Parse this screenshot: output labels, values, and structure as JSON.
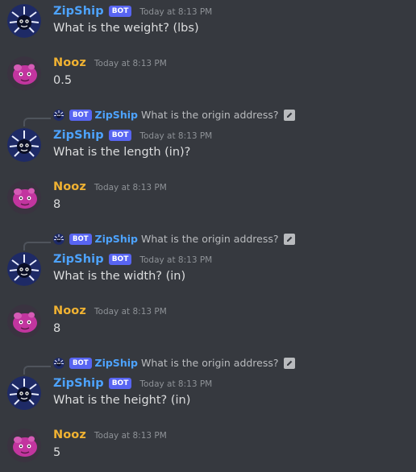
{
  "colors": {
    "bot_name": "#4da3ff",
    "user_name": "#f0b232",
    "bot_tag": "#5865f2",
    "background": "#36393f"
  },
  "messages": [
    {
      "author": "ZipShip",
      "is_bot": true,
      "bot_tag": "BOT",
      "timestamp": "Today at 8:13 PM",
      "text": "What is the weight? (lbs)",
      "avatar_icon": "zipship-avatar-icon"
    },
    {
      "author": "Nooz",
      "is_bot": false,
      "timestamp": "Today at 8:13 PM",
      "text": "0.5",
      "avatar_icon": "nooz-avatar-icon"
    },
    {
      "reply": {
        "author": "ZipShip",
        "bot_tag": "BOT",
        "text": "What is the origin address?"
      },
      "author": "ZipShip",
      "is_bot": true,
      "bot_tag": "BOT",
      "timestamp": "Today at 8:13 PM",
      "text": "What is the length (in)?",
      "avatar_icon": "zipship-avatar-icon"
    },
    {
      "author": "Nooz",
      "is_bot": false,
      "timestamp": "Today at 8:13 PM",
      "text": "8",
      "avatar_icon": "nooz-avatar-icon"
    },
    {
      "reply": {
        "author": "ZipShip",
        "bot_tag": "BOT",
        "text": "What is the origin address?"
      },
      "author": "ZipShip",
      "is_bot": true,
      "bot_tag": "BOT",
      "timestamp": "Today at 8:13 PM",
      "text": "What is the width? (in)",
      "avatar_icon": "zipship-avatar-icon"
    },
    {
      "author": "Nooz",
      "is_bot": false,
      "timestamp": "Today at 8:13 PM",
      "text": "8",
      "avatar_icon": "nooz-avatar-icon"
    },
    {
      "reply": {
        "author": "ZipShip",
        "bot_tag": "BOT",
        "text": "What is the origin address?"
      },
      "author": "ZipShip",
      "is_bot": true,
      "bot_tag": "BOT",
      "timestamp": "Today at 8:13 PM",
      "text": "What is the height? (in)",
      "avatar_icon": "zipship-avatar-icon"
    },
    {
      "author": "Nooz",
      "is_bot": false,
      "timestamp": "Today at 8:13 PM",
      "text": "5",
      "avatar_icon": "nooz-avatar-icon"
    }
  ]
}
